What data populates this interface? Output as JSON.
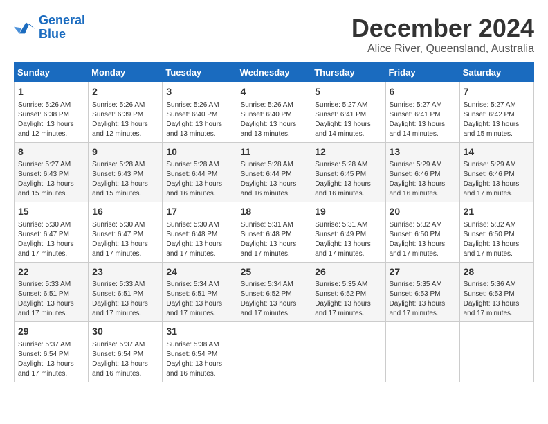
{
  "logo": {
    "line1": "General",
    "line2": "Blue"
  },
  "title": "December 2024",
  "subtitle": "Alice River, Queensland, Australia",
  "weekdays": [
    "Sunday",
    "Monday",
    "Tuesday",
    "Wednesday",
    "Thursday",
    "Friday",
    "Saturday"
  ],
  "weeks": [
    [
      {
        "day": "1",
        "info": "Sunrise: 5:26 AM\nSunset: 6:38 PM\nDaylight: 13 hours\nand 12 minutes."
      },
      {
        "day": "2",
        "info": "Sunrise: 5:26 AM\nSunset: 6:39 PM\nDaylight: 13 hours\nand 12 minutes."
      },
      {
        "day": "3",
        "info": "Sunrise: 5:26 AM\nSunset: 6:40 PM\nDaylight: 13 hours\nand 13 minutes."
      },
      {
        "day": "4",
        "info": "Sunrise: 5:26 AM\nSunset: 6:40 PM\nDaylight: 13 hours\nand 13 minutes."
      },
      {
        "day": "5",
        "info": "Sunrise: 5:27 AM\nSunset: 6:41 PM\nDaylight: 13 hours\nand 14 minutes."
      },
      {
        "day": "6",
        "info": "Sunrise: 5:27 AM\nSunset: 6:41 PM\nDaylight: 13 hours\nand 14 minutes."
      },
      {
        "day": "7",
        "info": "Sunrise: 5:27 AM\nSunset: 6:42 PM\nDaylight: 13 hours\nand 15 minutes."
      }
    ],
    [
      {
        "day": "8",
        "info": "Sunrise: 5:27 AM\nSunset: 6:43 PM\nDaylight: 13 hours\nand 15 minutes."
      },
      {
        "day": "9",
        "info": "Sunrise: 5:28 AM\nSunset: 6:43 PM\nDaylight: 13 hours\nand 15 minutes."
      },
      {
        "day": "10",
        "info": "Sunrise: 5:28 AM\nSunset: 6:44 PM\nDaylight: 13 hours\nand 16 minutes."
      },
      {
        "day": "11",
        "info": "Sunrise: 5:28 AM\nSunset: 6:44 PM\nDaylight: 13 hours\nand 16 minutes."
      },
      {
        "day": "12",
        "info": "Sunrise: 5:28 AM\nSunset: 6:45 PM\nDaylight: 13 hours\nand 16 minutes."
      },
      {
        "day": "13",
        "info": "Sunrise: 5:29 AM\nSunset: 6:46 PM\nDaylight: 13 hours\nand 16 minutes."
      },
      {
        "day": "14",
        "info": "Sunrise: 5:29 AM\nSunset: 6:46 PM\nDaylight: 13 hours\nand 17 minutes."
      }
    ],
    [
      {
        "day": "15",
        "info": "Sunrise: 5:30 AM\nSunset: 6:47 PM\nDaylight: 13 hours\nand 17 minutes."
      },
      {
        "day": "16",
        "info": "Sunrise: 5:30 AM\nSunset: 6:47 PM\nDaylight: 13 hours\nand 17 minutes."
      },
      {
        "day": "17",
        "info": "Sunrise: 5:30 AM\nSunset: 6:48 PM\nDaylight: 13 hours\nand 17 minutes."
      },
      {
        "day": "18",
        "info": "Sunrise: 5:31 AM\nSunset: 6:48 PM\nDaylight: 13 hours\nand 17 minutes."
      },
      {
        "day": "19",
        "info": "Sunrise: 5:31 AM\nSunset: 6:49 PM\nDaylight: 13 hours\nand 17 minutes."
      },
      {
        "day": "20",
        "info": "Sunrise: 5:32 AM\nSunset: 6:50 PM\nDaylight: 13 hours\nand 17 minutes."
      },
      {
        "day": "21",
        "info": "Sunrise: 5:32 AM\nSunset: 6:50 PM\nDaylight: 13 hours\nand 17 minutes."
      }
    ],
    [
      {
        "day": "22",
        "info": "Sunrise: 5:33 AM\nSunset: 6:51 PM\nDaylight: 13 hours\nand 17 minutes."
      },
      {
        "day": "23",
        "info": "Sunrise: 5:33 AM\nSunset: 6:51 PM\nDaylight: 13 hours\nand 17 minutes."
      },
      {
        "day": "24",
        "info": "Sunrise: 5:34 AM\nSunset: 6:51 PM\nDaylight: 13 hours\nand 17 minutes."
      },
      {
        "day": "25",
        "info": "Sunrise: 5:34 AM\nSunset: 6:52 PM\nDaylight: 13 hours\nand 17 minutes."
      },
      {
        "day": "26",
        "info": "Sunrise: 5:35 AM\nSunset: 6:52 PM\nDaylight: 13 hours\nand 17 minutes."
      },
      {
        "day": "27",
        "info": "Sunrise: 5:35 AM\nSunset: 6:53 PM\nDaylight: 13 hours\nand 17 minutes."
      },
      {
        "day": "28",
        "info": "Sunrise: 5:36 AM\nSunset: 6:53 PM\nDaylight: 13 hours\nand 17 minutes."
      }
    ],
    [
      {
        "day": "29",
        "info": "Sunrise: 5:37 AM\nSunset: 6:54 PM\nDaylight: 13 hours\nand 17 minutes."
      },
      {
        "day": "30",
        "info": "Sunrise: 5:37 AM\nSunset: 6:54 PM\nDaylight: 13 hours\nand 16 minutes."
      },
      {
        "day": "31",
        "info": "Sunrise: 5:38 AM\nSunset: 6:54 PM\nDaylight: 13 hours\nand 16 minutes."
      },
      null,
      null,
      null,
      null
    ]
  ]
}
